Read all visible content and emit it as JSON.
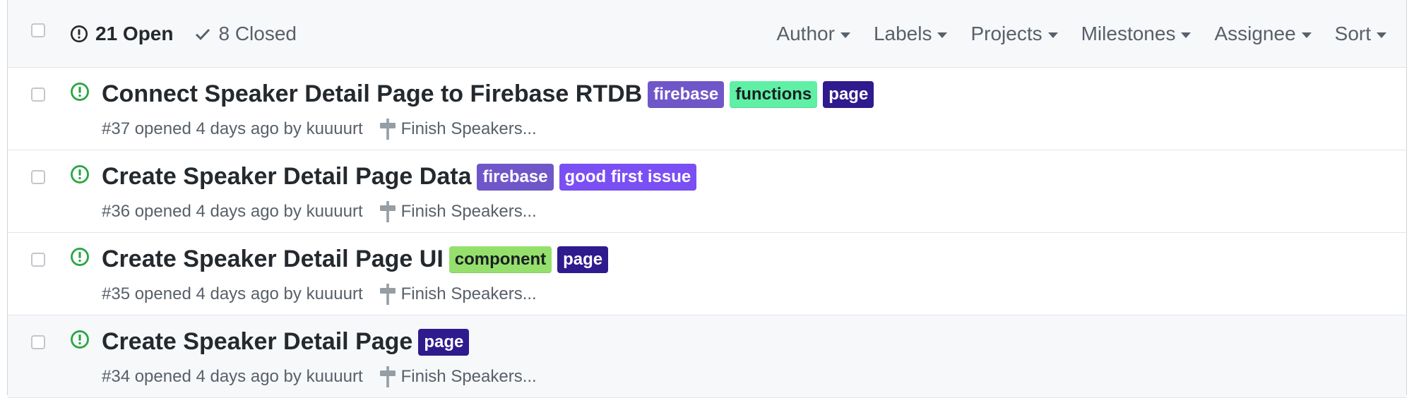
{
  "header": {
    "open_count_label": "21 Open",
    "closed_count_label": "8 Closed",
    "filters": [
      {
        "label": "Author"
      },
      {
        "label": "Labels"
      },
      {
        "label": "Projects"
      },
      {
        "label": "Milestones"
      },
      {
        "label": "Assignee"
      },
      {
        "label": "Sort"
      }
    ]
  },
  "colors": {
    "open_icon": "#28a745",
    "firebase": "#7057c9",
    "functions": "#5ff0a6",
    "page": "#2f1a8e",
    "good_first_issue": "#7a4ff3",
    "component": "#95e06d"
  },
  "issues": [
    {
      "title": "Connect Speaker Detail Page to Firebase RTDB",
      "labels": [
        {
          "text": "firebase",
          "bg": "#7057c9",
          "fg": "#ffffff"
        },
        {
          "text": "functions",
          "bg": "#5ff0a6",
          "fg": "#1b1f23"
        },
        {
          "text": "page",
          "bg": "#2f1a8e",
          "fg": "#ffffff"
        }
      ],
      "meta": "#37 opened 4 days ago by kuuuurt",
      "milestone": "Finish Speakers..."
    },
    {
      "title": "Create Speaker Detail Page Data",
      "labels": [
        {
          "text": "firebase",
          "bg": "#7057c9",
          "fg": "#ffffff"
        },
        {
          "text": "good first issue",
          "bg": "#7a4ff3",
          "fg": "#ffffff"
        }
      ],
      "meta": "#36 opened 4 days ago by kuuuurt",
      "milestone": "Finish Speakers..."
    },
    {
      "title": "Create Speaker Detail Page UI",
      "labels": [
        {
          "text": "component",
          "bg": "#95e06d",
          "fg": "#1b1f23"
        },
        {
          "text": "page",
          "bg": "#2f1a8e",
          "fg": "#ffffff"
        }
      ],
      "meta": "#35 opened 4 days ago by kuuuurt",
      "milestone": "Finish Speakers..."
    },
    {
      "title": "Create Speaker Detail Page",
      "labels": [
        {
          "text": "page",
          "bg": "#2f1a8e",
          "fg": "#ffffff"
        }
      ],
      "meta": "#34 opened 4 days ago by kuuuurt",
      "milestone": "Finish Speakers..."
    }
  ]
}
